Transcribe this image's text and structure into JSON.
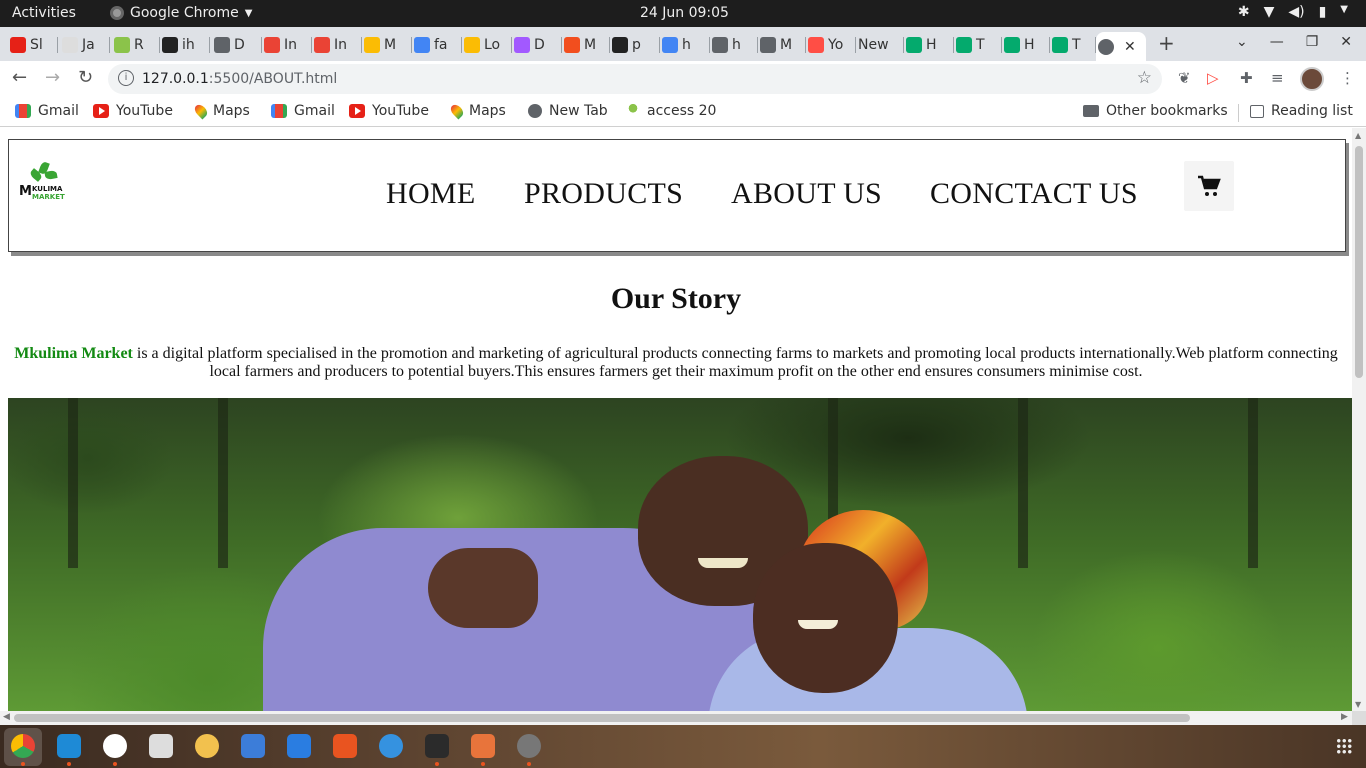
{
  "system_bar": {
    "activities": "Activities",
    "app_name": "Google Chrome",
    "clock": "24 Jun  09:05"
  },
  "tabs": [
    {
      "label": "Sl",
      "color": "#e62117"
    },
    {
      "label": "Ja",
      "color": "#dddddd"
    },
    {
      "label": "R",
      "color": "#8bc34a"
    },
    {
      "label": "ih",
      "color": "#222222"
    },
    {
      "label": "D",
      "color": "#5f6368"
    },
    {
      "label": "In",
      "color": "#ea4335"
    },
    {
      "label": "In",
      "color": "#ea4335"
    },
    {
      "label": "M",
      "color": "#fbbc04"
    },
    {
      "label": "fa",
      "color": "#4285f4"
    },
    {
      "label": "Lo",
      "color": "#fbbc04"
    },
    {
      "label": "D",
      "color": "#a259ff"
    },
    {
      "label": "M",
      "color": "#f24e1e"
    },
    {
      "label": "p",
      "color": "#222222"
    },
    {
      "label": "h",
      "color": "#4285f4"
    },
    {
      "label": "h",
      "color": "#5f6368"
    },
    {
      "label": "M",
      "color": "#5f6368"
    },
    {
      "label": "Yo",
      "color": "#ff4e45"
    },
    {
      "label": "New",
      "color": ""
    },
    {
      "label": "H",
      "color": "#04aa6d"
    },
    {
      "label": "T",
      "color": "#04aa6d"
    },
    {
      "label": "H",
      "color": "#04aa6d"
    },
    {
      "label": "T",
      "color": "#04aa6d"
    }
  ],
  "address": {
    "host": "127.0.0.1",
    "path": ":5500/ABOUT.html"
  },
  "bookmarks": {
    "items": [
      "Gmail",
      "YouTube",
      "Maps",
      "Gmail",
      "YouTube",
      "Maps",
      "New Tab",
      "access 20"
    ],
    "other": "Other bookmarks",
    "reading_list": "Reading list"
  },
  "site": {
    "logo_text_m": "M",
    "logo_text_kulima": "KULIMA",
    "logo_text_market": "MARKET",
    "nav": [
      "HOME",
      "PRODUCTS",
      "ABOUT US",
      "CONCTACT US"
    ],
    "title": "Our Story",
    "brand_name": "Mkulima Market",
    "story": " is a digital platform specialised in the promotion and marketing of agricultural products connecting farms to markets and promoting local products internationally.Web platform connecting local farmers and producers to potential buyers.This ensures farmers get their maximum profit on the other end ensures consumers minimise cost.",
    "brand_color": "#138a13"
  }
}
